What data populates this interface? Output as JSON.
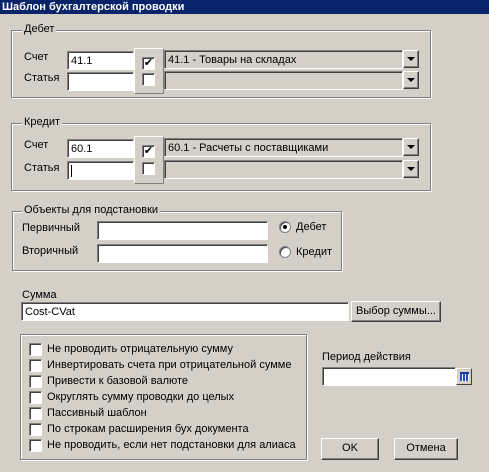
{
  "window": {
    "title": "Шаблон бухгалтерской проводки"
  },
  "debit": {
    "legend": "Дебет",
    "account_label": "Счет",
    "article_label": "Статья",
    "account_value": "41.1",
    "account_checked": true,
    "account_checkmark": "✔",
    "account_desc": "41.1 - Товары на складах",
    "article_value": "",
    "article_checked": false,
    "article_desc": ""
  },
  "credit": {
    "legend": "Кредит",
    "account_label": "Счет",
    "article_label": "Статья",
    "account_value": "60.1",
    "account_checked": true,
    "account_checkmark": "✔",
    "account_desc": "60.1 - Расчеты с поставщиками",
    "article_value": "",
    "article_checked": false,
    "article_desc": ""
  },
  "substitution": {
    "legend": "Объекты для подстановки",
    "primary_label": "Первичный",
    "secondary_label": "Вторичный",
    "primary_value": "",
    "secondary_value": "",
    "radio_debit": "Дебет",
    "radio_credit": "Кредит",
    "selected": "debit"
  },
  "sum": {
    "label": "Сумма",
    "value": "Cost-CVat",
    "choose_button": "Выбор суммы..."
  },
  "options": [
    {
      "label": "Не проводить отрицательную сумму",
      "checked": false
    },
    {
      "label": "Инвертировать счета при отрицательной сумме",
      "checked": false
    },
    {
      "label": "Привести к базовой валюте",
      "checked": false
    },
    {
      "label": "Округлять сумму проводки до целых",
      "checked": false
    },
    {
      "label": "Пассивный шаблон",
      "checked": false
    },
    {
      "label": "По строкам расширения бух документа",
      "checked": false
    },
    {
      "label": "Не проводить, если нет подстановки для алиаса",
      "checked": false
    }
  ],
  "period": {
    "label": "Период действия",
    "value": ""
  },
  "buttons": {
    "ok": "OK",
    "cancel": "Отмена"
  }
}
